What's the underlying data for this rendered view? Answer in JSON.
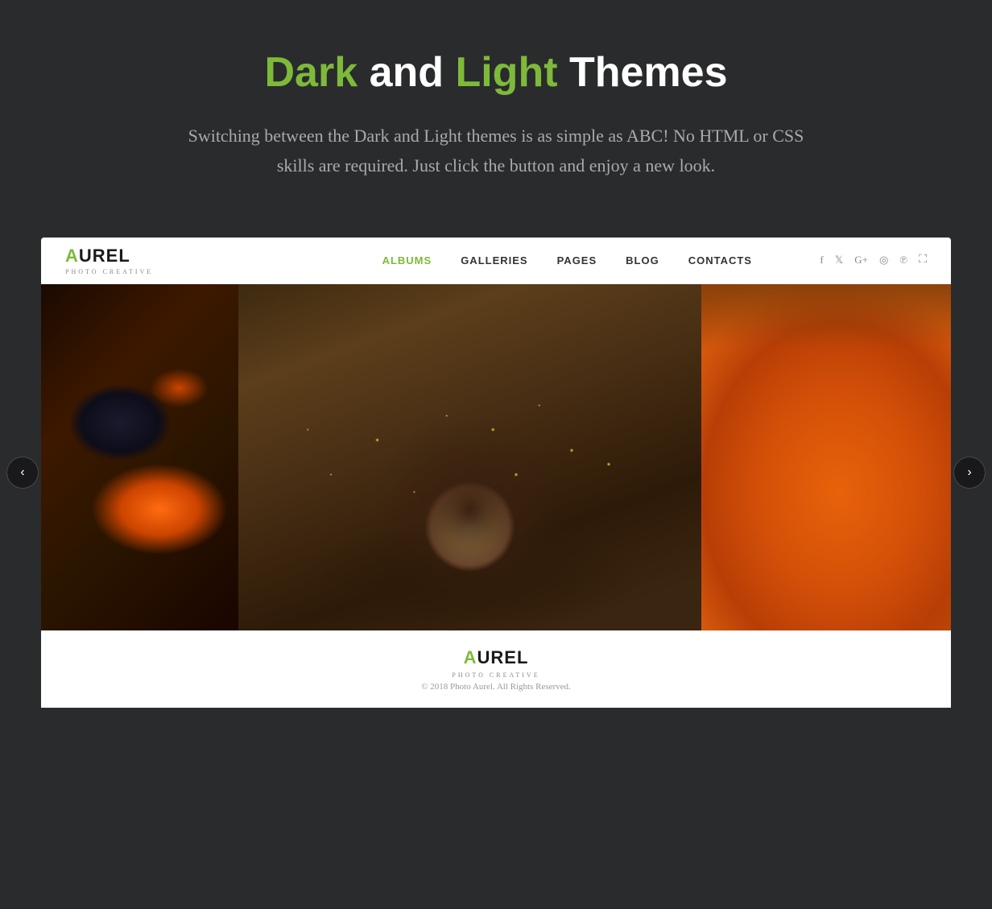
{
  "header": {
    "title_dark": "Dark",
    "title_and": " and ",
    "title_light": "Light",
    "title_themes": " Themes",
    "subtitle": "Switching between the Dark and Light themes is as simple as ABC! No HTML or CSS skills are required. Just click the button and enjoy a new look."
  },
  "nav": {
    "logo_a": "A",
    "logo_rest": "UREL",
    "logo_sub": "PHOTO CREATIVE",
    "links": [
      {
        "label": "ALBUMS",
        "active": true
      },
      {
        "label": "GALLERIES",
        "active": false
      },
      {
        "label": "PAGES",
        "active": false
      },
      {
        "label": "BLOG",
        "active": false
      },
      {
        "label": "CONTACTS",
        "active": false
      }
    ],
    "social_icons": [
      "f",
      "t",
      "g+",
      "◎",
      "℗"
    ],
    "fullscreen": "⛶"
  },
  "gallery": {
    "prev_label": "‹",
    "next_label": "›"
  },
  "footer": {
    "logo_a": "A",
    "logo_rest": "UREL",
    "logo_sub": "PHOTO CREATIVE",
    "copyright": "© 2018 Photo Aurel. All Rights Reserved."
  }
}
